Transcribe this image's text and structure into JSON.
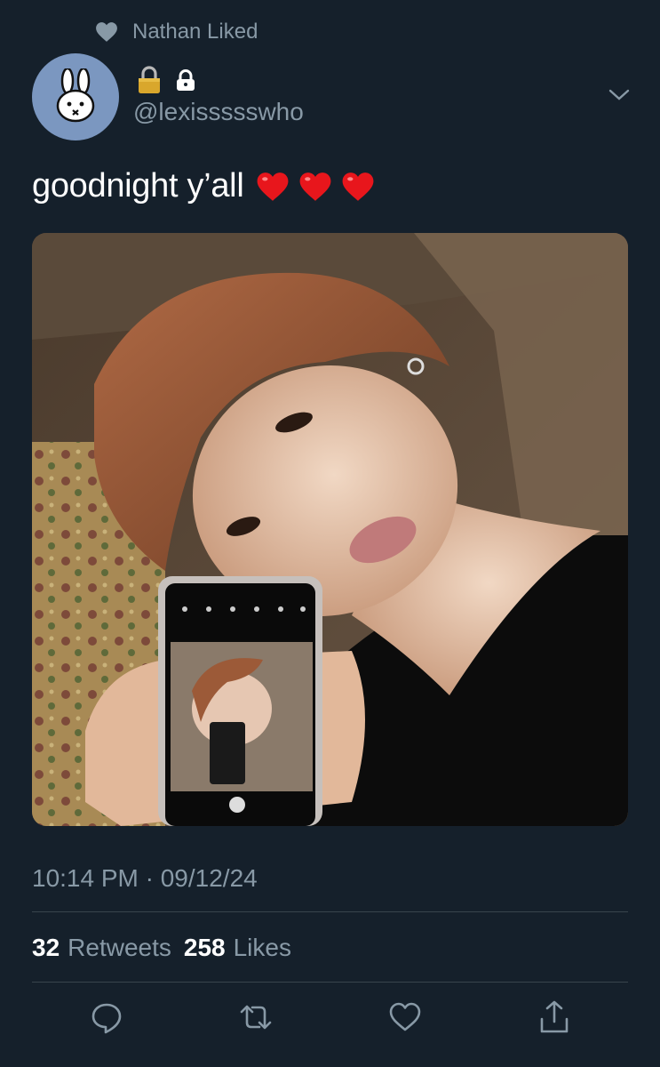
{
  "context": {
    "text": "Nathan Liked",
    "icon": "heart-icon"
  },
  "author": {
    "handle": "@lexissssswho",
    "avatar_icon": "bunny-icon",
    "avatar_color": "#7b97c0",
    "name_icons": [
      "lock-emoji-icon",
      "lock-icon"
    ]
  },
  "tweet": {
    "text": "goodnight y’all",
    "emoji": [
      "heart-emoji",
      "heart-emoji",
      "heart-emoji"
    ]
  },
  "meta": {
    "timestamp": "10:14 PM · 09/12/24"
  },
  "stats": {
    "retweets_count": "32",
    "retweets_label": "Retweets",
    "likes_count": "258",
    "likes_label": "Likes"
  },
  "actions": [
    "reply-icon",
    "retweet-icon",
    "like-icon",
    "share-icon"
  ],
  "colors": {
    "background": "#15202b",
    "secondary_text": "#8899a6",
    "divider": "#38444d",
    "heart_red": "#e0245e"
  }
}
